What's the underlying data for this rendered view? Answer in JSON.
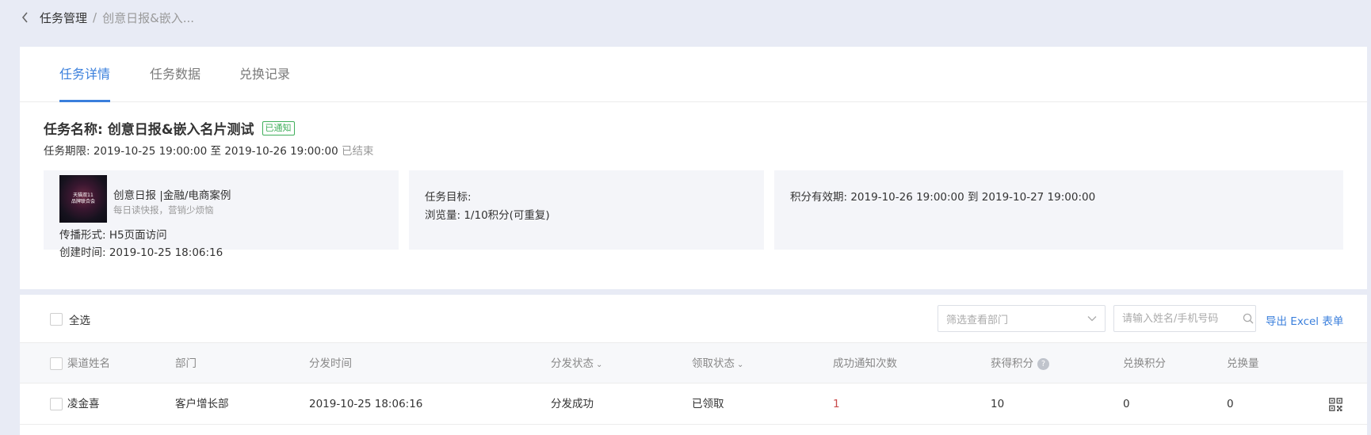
{
  "breadcrumb": {
    "parent": "任务管理",
    "separator": "/",
    "current": "创意日报&嵌入..."
  },
  "tabs": [
    {
      "label": "任务详情",
      "active": true
    },
    {
      "label": "任务数据",
      "active": false
    },
    {
      "label": "兑换记录",
      "active": false
    }
  ],
  "task": {
    "title": "任务名称: 创意日报&嵌入名片测试",
    "badge": "已通知",
    "period_prefix": "任务期限: ",
    "start": "2019-10-25 19:00:00",
    "to": " 至 ",
    "end": "2019-10-26 19:00:00",
    "status": "已结束"
  },
  "article": {
    "thumb_line1": "天猫双11",
    "thumb_line2": "品牌联合会",
    "title": "创意日报 |金融/电商案例",
    "subtitle": "每日读快报，营销少烦恼",
    "spread": "传播形式: H5页面访问",
    "created": "创建时间: 2019-10-25 18:06:16"
  },
  "target": {
    "label": "任务目标:",
    "value": "浏览量: 1/10积分(可重复)"
  },
  "validity": {
    "text": "积分有效期: 2019-10-26 19:00:00 到 2019-10-27 19:00:00"
  },
  "toolbar": {
    "select_all": "全选",
    "dept_placeholder": "筛选查看部门",
    "search_placeholder": "请输入姓名/手机号码",
    "export": "导出 Excel 表单"
  },
  "table": {
    "headers": {
      "name": "渠道姓名",
      "dept": "部门",
      "time": "分发时间",
      "dist_status": "分发状态",
      "recv_status": "领取状态",
      "success": "成功通知次数",
      "points": "获得积分",
      "exchanged": "兑换积分",
      "amount": "兑换量"
    },
    "rows": [
      {
        "name": "凌金喜",
        "dept": "客户增长部",
        "time": "2019-10-25 18:06:16",
        "dist_status": "分发成功",
        "recv_status": "已领取",
        "success": "1",
        "points": "10",
        "exchanged": "0",
        "amount": "0"
      }
    ]
  },
  "colors": {
    "accent": "#3a7fdc",
    "badge_green": "#3fae5a",
    "alert_red": "#c94b4b",
    "bg": "#e8ebf5"
  },
  "icons": {
    "back": "chevron-left-icon",
    "dropdown": "chevron-down-icon",
    "search": "search-icon",
    "help": "question-icon",
    "qr": "qr-code-icon"
  }
}
